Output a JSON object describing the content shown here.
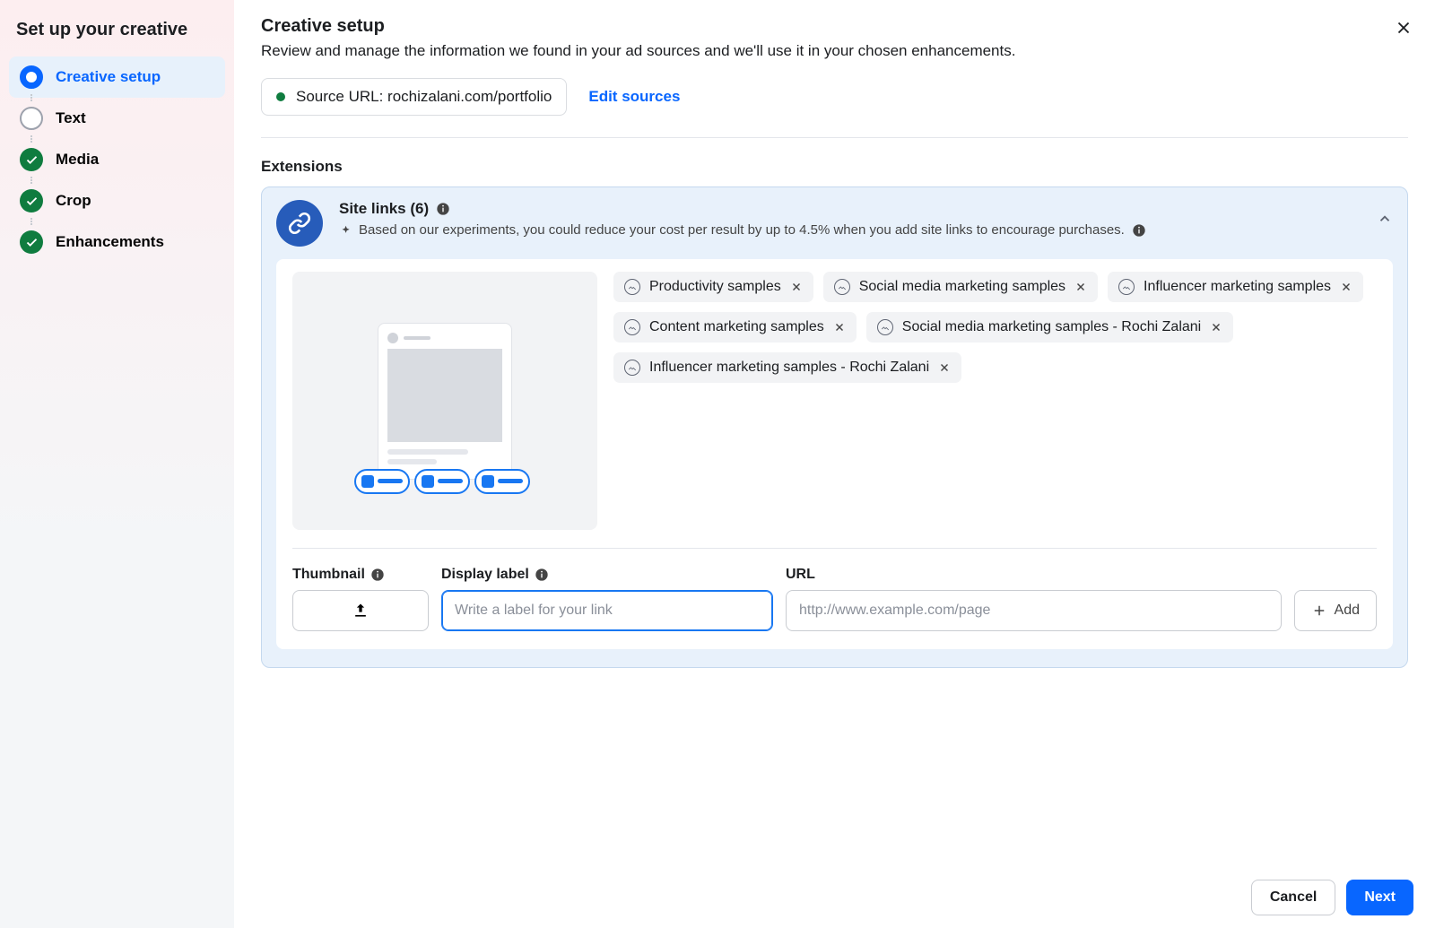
{
  "sidebar": {
    "title": "Set up your creative",
    "steps": [
      {
        "label": "Creative setup",
        "state": "current"
      },
      {
        "label": "Text",
        "state": "empty"
      },
      {
        "label": "Media",
        "state": "done"
      },
      {
        "label": "Crop",
        "state": "done"
      },
      {
        "label": "Enhancements",
        "state": "done"
      }
    ]
  },
  "header": {
    "title": "Creative setup",
    "subtitle": "Review and manage the information we found in your ad sources and we'll use it in your chosen enhancements."
  },
  "source": {
    "text": "Source URL: rochizalani.com/portfolio",
    "edit": "Edit sources"
  },
  "extensions": {
    "label": "Extensions",
    "title": "Site links (6)",
    "description": "Based on our experiments, you could reduce your cost per result by up to 4.5% when you add site links to encourage purchases.",
    "chips": [
      "Productivity samples",
      "Social media marketing samples",
      "Influencer marketing samples",
      "Content marketing samples",
      "Social media marketing samples - Rochi Zalani",
      "Influencer marketing samples - Rochi Zalani"
    ]
  },
  "form": {
    "thumbnail_label": "Thumbnail",
    "display_label": "Display label",
    "display_placeholder": "Write a label for your link",
    "url_label": "URL",
    "url_placeholder": "http://www.example.com/page",
    "add": "Add"
  },
  "footer": {
    "cancel": "Cancel",
    "next": "Next"
  }
}
